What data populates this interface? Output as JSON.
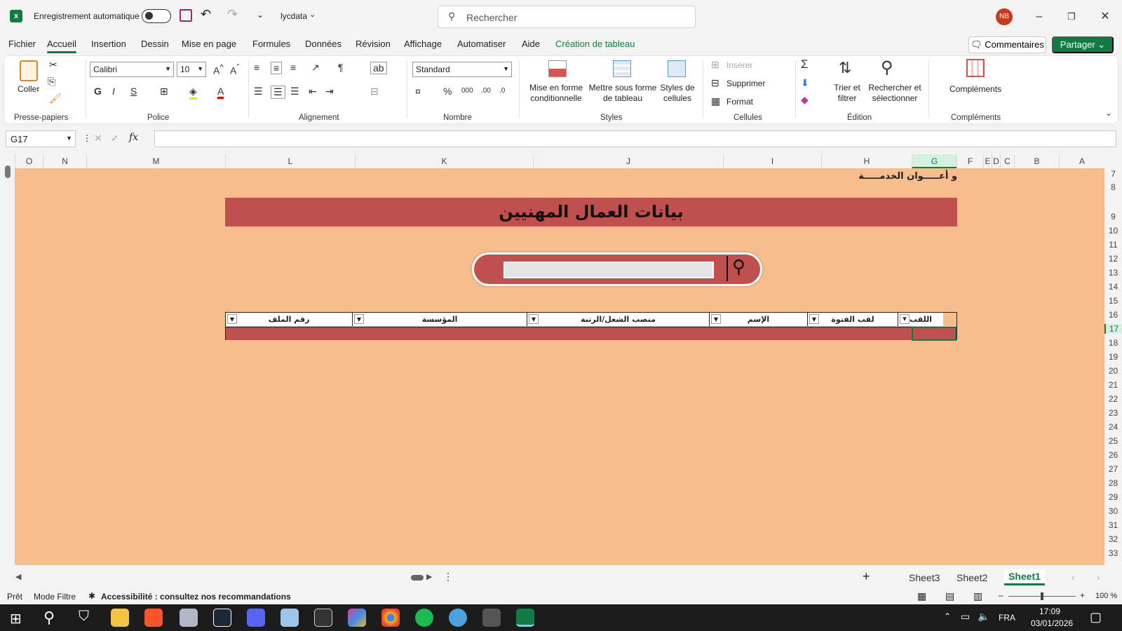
{
  "titlebar": {
    "autosave_label": "Enregistrement automatique",
    "filename": "lycdata",
    "search_placeholder": "Rechercher",
    "avatar_initials": "NB"
  },
  "menu": {
    "items": [
      "Fichier",
      "Accueil",
      "Insertion",
      "Dessin",
      "Mise en page",
      "Formules",
      "Données",
      "Révision",
      "Affichage",
      "Automatiser",
      "Aide",
      "Création de tableau"
    ],
    "active": "Accueil",
    "comments_label": "Commentaires",
    "share_label": "Partager"
  },
  "ribbon": {
    "clipboard": {
      "paste": "Coller",
      "group": "Presse-papiers"
    },
    "font": {
      "name": "Calibri",
      "size": "10",
      "bold": "G",
      "italic": "I",
      "underline": "S",
      "color_a": "A",
      "group": "Police"
    },
    "alignment": {
      "group": "Alignement"
    },
    "number": {
      "format": "Standard",
      "group": "Nombre"
    },
    "styles": {
      "conditional": "Mise en forme conditionnelle",
      "as_table": "Mettre sous forme de tableau",
      "cell_styles": "Styles de cellules",
      "group": "Styles"
    },
    "cells": {
      "insert": "Insérer",
      "delete": "Supprimer",
      "format": "Format",
      "group": "Cellules"
    },
    "editing": {
      "sort": "Trier et filtrer",
      "find": "Rechercher et sélectionner",
      "group": "Édition"
    },
    "addins": {
      "label": "Compléments",
      "group": "Compléments"
    }
  },
  "formula_bar": {
    "name_box": "G17",
    "fx": "fx",
    "content": ""
  },
  "columns": [
    "O",
    "N",
    "M",
    "L",
    "K",
    "J",
    "I",
    "H",
    "G",
    "F",
    "E",
    "D",
    "C",
    "B",
    "A"
  ],
  "rows": [
    "7",
    "8",
    "9",
    "10",
    "11",
    "12",
    "13",
    "14",
    "15",
    "16",
    "17",
    "18",
    "19",
    "20",
    "21",
    "22",
    "23",
    "24",
    "25",
    "26",
    "27",
    "28",
    "29",
    "30",
    "31",
    "32",
    "33"
  ],
  "sheet": {
    "top_note": "و أعـــــوان الخدمـــــة",
    "title": "بيانات العمال المهنيين",
    "search_value": "",
    "table_headers": [
      "اللقب",
      "لقب الفتوة",
      "الإسم",
      "منصب الشغل/الرتبة",
      "المؤسسة",
      "رقم الملف"
    ],
    "bg_color": "#f8bd8d",
    "accent_color": "#c0504d"
  },
  "sheet_tabs": {
    "tabs": [
      "Sheet3",
      "Sheet2",
      "Sheet1"
    ],
    "active": "Sheet1"
  },
  "status": {
    "ready": "Prêt",
    "mode": "Mode Filtre",
    "accessibility": "Accessibilité : consultez nos recommandations",
    "zoom": "100 %"
  },
  "taskbar": {
    "lang": "FRA",
    "time": "17:09",
    "date": "03/01/2026"
  }
}
